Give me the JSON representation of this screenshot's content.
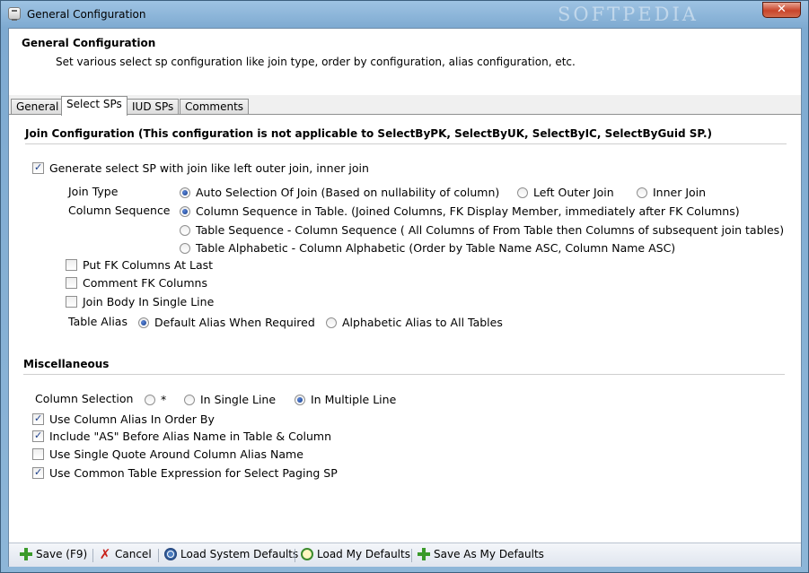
{
  "window": {
    "title": "General Configuration",
    "watermark": "SOFTPEDIA",
    "close_glyph": "✕"
  },
  "header": {
    "title": "General Configuration",
    "description": "Set various select sp configuration like join type, order by configuration, alias configuration, etc."
  },
  "tabs": [
    {
      "label": "General",
      "active": false
    },
    {
      "label": "Select SPs",
      "active": true
    },
    {
      "label": "IUD SPs",
      "active": false
    },
    {
      "label": "Comments",
      "active": false
    }
  ],
  "join_config": {
    "title": "Join Configuration (This configuration is not applicable to SelectByPK, SelectByUK, SelectByIC, SelectByGuid SP.)",
    "generate_join": {
      "label": "Generate select SP with join like left outer join, inner join",
      "checked": true
    },
    "join_type": {
      "label": "Join Type",
      "options": [
        {
          "label": "Auto Selection Of Join (Based on nullability of column)",
          "selected": true
        },
        {
          "label": "Left Outer Join",
          "selected": false
        },
        {
          "label": "Inner Join",
          "selected": false
        }
      ]
    },
    "column_sequence": {
      "label": "Column Sequence",
      "options": [
        {
          "label": "Column Sequence in Table. (Joined Columns, FK Display Member, immediately after FK Columns)",
          "selected": true
        },
        {
          "label": "Table Sequence - Column Sequence ( All Columns of From Table then Columns of subsequent join tables)",
          "selected": false
        },
        {
          "label": "Table Alphabetic - Column Alphabetic (Order by Table Name ASC, Column Name ASC)",
          "selected": false
        }
      ]
    },
    "checkboxes": [
      {
        "label": "Put FK Columns At Last",
        "checked": false
      },
      {
        "label": "Comment FK Columns",
        "checked": false
      },
      {
        "label": "Join Body In Single Line",
        "checked": false
      }
    ],
    "table_alias": {
      "label": "Table Alias",
      "options": [
        {
          "label": "Default Alias When Required",
          "selected": true
        },
        {
          "label": "Alphabetic Alias to All Tables",
          "selected": false
        }
      ]
    }
  },
  "misc": {
    "title": "Miscellaneous",
    "column_selection": {
      "label": "Column Selection",
      "options": [
        {
          "label": "*",
          "selected": false
        },
        {
          "label": "In Single Line",
          "selected": false
        },
        {
          "label": "In Multiple Line",
          "selected": true
        }
      ]
    },
    "checkboxes": [
      {
        "label": "Use Column Alias In Order By",
        "checked": true
      },
      {
        "label": "Include \"AS\" Before Alias Name in Table & Column",
        "checked": true
      },
      {
        "label": "Use Single Quote Around Column Alias Name",
        "checked": false
      },
      {
        "label": "Use Common Table Expression for Select Paging SP",
        "checked": true
      }
    ]
  },
  "toolbar": {
    "save": "Save (F9)",
    "cancel": "Cancel",
    "load_system_defaults": "Load System Defaults",
    "load_my_defaults": "Load My Defaults",
    "save_as_my_defaults": "Save As My Defaults"
  },
  "colors": {
    "accent_check": "#1c3f8a",
    "save_icon": "#3a9a2a",
    "cancel_icon": "#c8201a"
  }
}
